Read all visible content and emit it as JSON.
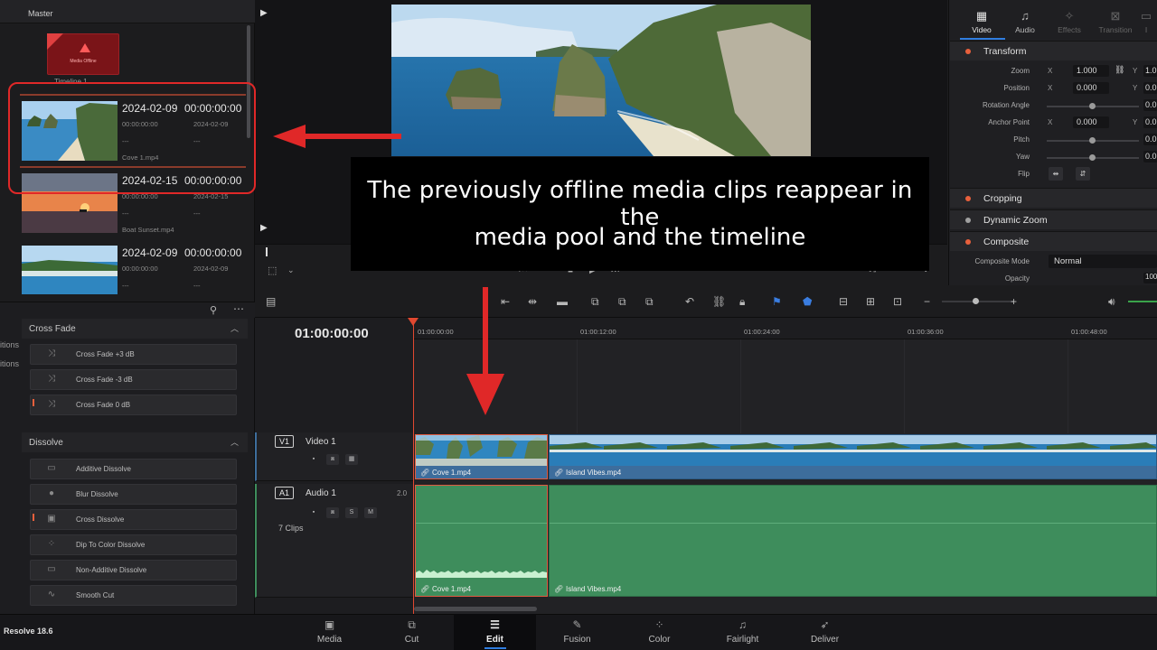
{
  "media_pool": {
    "header": "Master",
    "timeline_thumb_label": "Timeline 1",
    "timeline_thumb_text": "Media Offline",
    "clips": [
      {
        "date": "2024-02-09",
        "tc": "00:00:00:00",
        "sub_start": "00:00:00:00",
        "sub_date": "2024-02-09",
        "dash1": "---",
        "dash2": "---",
        "name": "Cove 1.mp4"
      },
      {
        "date": "2024-02-15",
        "tc": "00:00:00:00",
        "sub_start": "00:00:00:00",
        "sub_date": "2024-02-15",
        "dash1": "---",
        "dash2": "---",
        "name": "Boat Sunset.mp4"
      },
      {
        "date": "2024-02-09",
        "tc": "00:00:00:00",
        "sub_start": "00:00:00:00",
        "sub_date": "2024-02-09",
        "dash1": "---",
        "dash2": "---",
        "name": ""
      }
    ]
  },
  "inspector": {
    "tabs": [
      "Video",
      "Audio",
      "Effects",
      "Transition",
      "I"
    ],
    "sections": {
      "transform": "Transform",
      "cropping": "Cropping",
      "dynamic_zoom": "Dynamic Zoom",
      "composite": "Composite"
    },
    "props": {
      "zoom": {
        "label": "Zoom",
        "x": "1.000",
        "y": "1.0"
      },
      "position": {
        "label": "Position",
        "x": "0.000",
        "y": "0.0"
      },
      "rotation": {
        "label": "Rotation Angle",
        "v": "0.0"
      },
      "anchor": {
        "label": "Anchor Point",
        "x": "0.000",
        "y": "0.0"
      },
      "pitch": {
        "label": "Pitch",
        "v": "0.0"
      },
      "yaw": {
        "label": "Yaw",
        "v": "0.0"
      },
      "flip": {
        "label": "Flip"
      },
      "composite_mode": {
        "label": "Composite Mode",
        "value": "Normal"
      },
      "opacity": {
        "label": "Opacity",
        "value": "100"
      }
    },
    "axis_x": "X",
    "axis_y": "Y"
  },
  "effects": {
    "side_labels": [
      "itions",
      "itions"
    ],
    "groups": [
      {
        "title": "Cross Fade",
        "items": [
          "Cross Fade +3 dB",
          "Cross Fade -3 dB",
          "Cross Fade 0 dB"
        ]
      },
      {
        "title": "Dissolve",
        "items": [
          "Additive Dissolve",
          "Blur Dissolve",
          "Cross Dissolve",
          "Dip To Color Dissolve",
          "Non-Additive Dissolve",
          "Smooth Cut"
        ]
      }
    ]
  },
  "timeline": {
    "timecode": "01:00:00:00",
    "ruler": [
      "01:00:00:00",
      "01:00:12:00",
      "01:00:24:00",
      "01:00:36:00",
      "01:00:48:00"
    ],
    "video_track": {
      "id": "V1",
      "name": "Video 1"
    },
    "audio_track": {
      "id": "A1",
      "name": "Audio 1",
      "level": "2.0",
      "clips_count": "7 Clips",
      "solo": "S",
      "mute": "M"
    },
    "video_clips": [
      "Cove 1.mp4",
      "Island Vibes.mp4"
    ],
    "audio_clips": [
      "Cove 1.mp4",
      "Island Vibes.mp4"
    ]
  },
  "pages": [
    "Media",
    "Cut",
    "Edit",
    "Fusion",
    "Color",
    "Fairlight",
    "Deliver"
  ],
  "active_page": "Edit",
  "version": "Resolve 18.6",
  "caption": {
    "line1": "The previously offline media clips reappear in the",
    "line2": "media pool and the timeline"
  },
  "colors": {
    "annotation_red": "#e02828",
    "accent_orange": "#e8603c",
    "video_clip": "#3d6d9c",
    "audio_clip": "#3e8d5c",
    "active_blue": "#2f7de0"
  }
}
